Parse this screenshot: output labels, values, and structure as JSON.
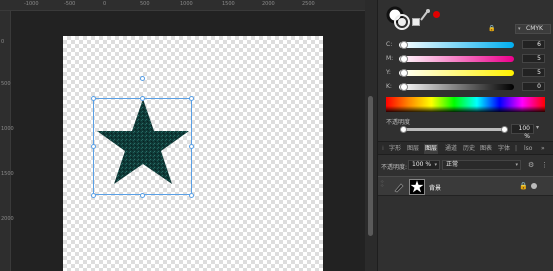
{
  "ruler": {
    "top_labels": [
      "-1000",
      "-500",
      "0",
      "500",
      "1000",
      "1500",
      "2000",
      "2500"
    ],
    "left_labels": [
      "0",
      "500",
      "1000",
      "1500",
      "2000"
    ]
  },
  "color_panel": {
    "model": "CMYK",
    "sliders": [
      {
        "key": "C",
        "label": "C:",
        "value": "6",
        "gradient": [
          "#ffffff",
          "#00aeef"
        ]
      },
      {
        "key": "M",
        "label": "M:",
        "value": "5",
        "gradient": [
          "#ffffff",
          "#ec008c"
        ]
      },
      {
        "key": "Y",
        "label": "Y:",
        "value": "5",
        "gradient": [
          "#ffffff",
          "#fff200"
        ]
      },
      {
        "key": "K",
        "label": "K:",
        "value": "0",
        "gradient": [
          "#ffffff",
          "#000000"
        ]
      }
    ],
    "opacity_label": "不透明度",
    "opacity_value": "100 %"
  },
  "layers_panel": {
    "tabs": [
      "字形",
      "图层",
      "图层",
      "通道",
      "历史",
      "图表",
      "字体",
      "lso"
    ],
    "active_tab_index": 2,
    "opacity_label": "不透明度:",
    "opacity_value": "100 %",
    "blend_mode": "正常",
    "layer_name": "背景"
  },
  "colors": {
    "selection": "#5aa0e6",
    "star_fill": "#0f3a38"
  }
}
